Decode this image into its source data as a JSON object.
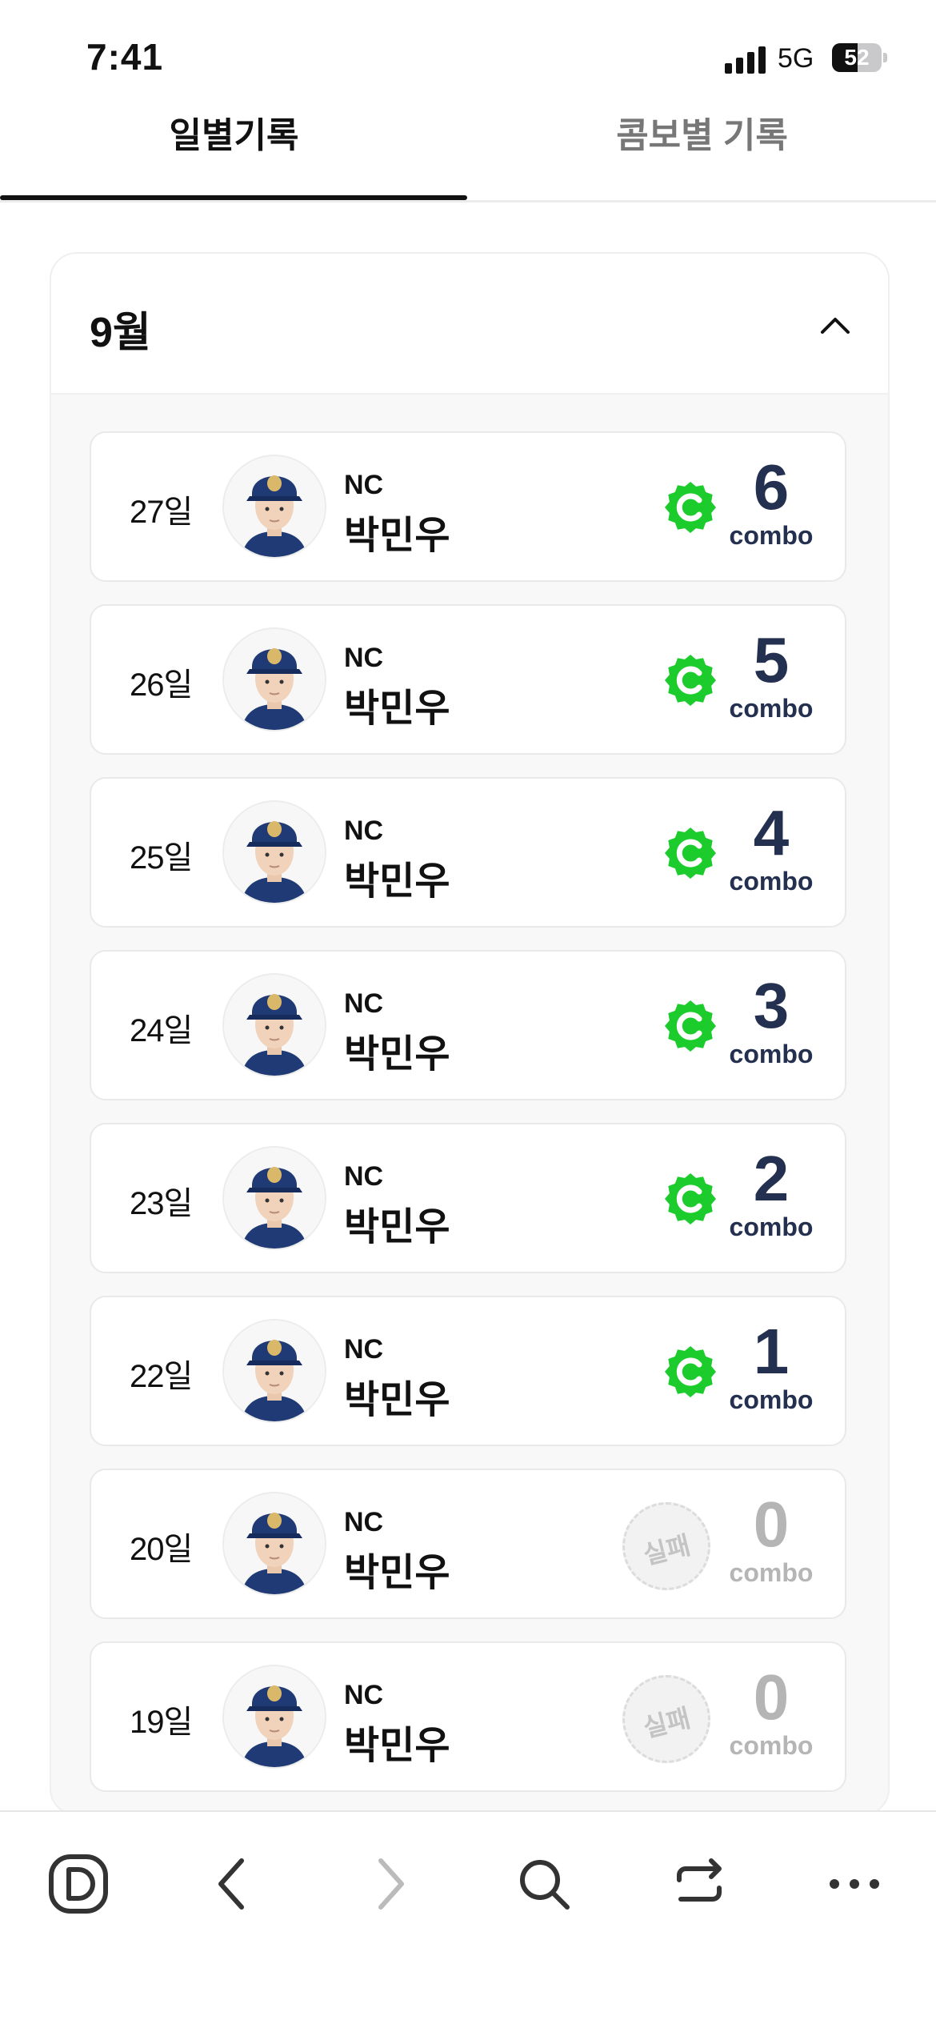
{
  "status_bar": {
    "time": "7:41",
    "network": "5G",
    "battery_level": "52",
    "battery_fraction": 0.52
  },
  "tabs": [
    {
      "label": "일별기록",
      "active": true
    },
    {
      "label": "콤보별 기록",
      "active": false
    }
  ],
  "month": {
    "title": "9월",
    "expanded": true
  },
  "records": [
    {
      "date": "27일",
      "team": "NC",
      "player": "박민우",
      "combo": "6",
      "combo_label": "combo",
      "status": "success"
    },
    {
      "date": "26일",
      "team": "NC",
      "player": "박민우",
      "combo": "5",
      "combo_label": "combo",
      "status": "success"
    },
    {
      "date": "25일",
      "team": "NC",
      "player": "박민우",
      "combo": "4",
      "combo_label": "combo",
      "status": "success"
    },
    {
      "date": "24일",
      "team": "NC",
      "player": "박민우",
      "combo": "3",
      "combo_label": "combo",
      "status": "success"
    },
    {
      "date": "23일",
      "team": "NC",
      "player": "박민우",
      "combo": "2",
      "combo_label": "combo",
      "status": "success"
    },
    {
      "date": "22일",
      "team": "NC",
      "player": "박민우",
      "combo": "1",
      "combo_label": "combo",
      "status": "success"
    },
    {
      "date": "20일",
      "team": "NC",
      "player": "박민우",
      "combo": "0",
      "combo_label": "combo",
      "status": "fail",
      "fail_label": "실패"
    },
    {
      "date": "19일",
      "team": "NC",
      "player": "박민우",
      "combo": "0",
      "combo_label": "combo",
      "status": "fail",
      "fail_label": "실패"
    }
  ],
  "toolbar": {
    "items": [
      "daum-icon",
      "back-icon",
      "forward-icon",
      "search-icon",
      "switch-icon",
      "more-icon"
    ],
    "forward_enabled": false
  },
  "colors": {
    "success_badge": "#1ccb2c",
    "combo_text": "#24304f",
    "fail_text": "#b5b5b5",
    "team_cap": "#1f3a75"
  }
}
